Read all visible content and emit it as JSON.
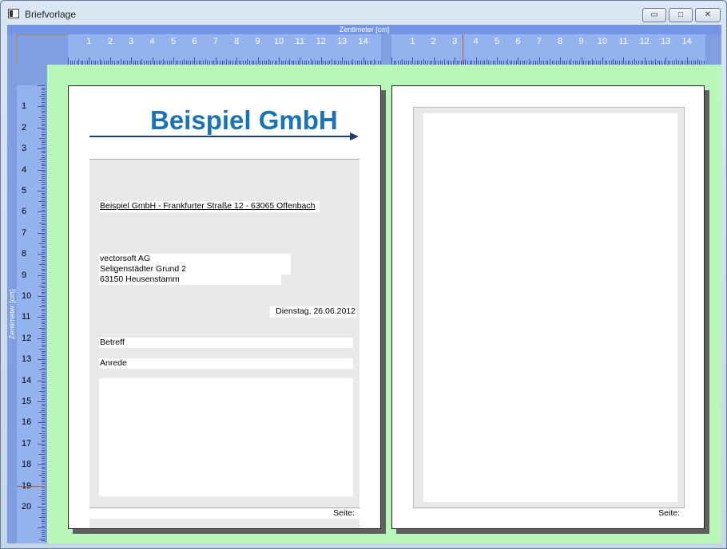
{
  "window": {
    "title": "Briefvorlage",
    "minimize": "▭",
    "maximize": "□",
    "close": "✕"
  },
  "ruler": {
    "top_caption": "Zentimeter [cm]",
    "left_caption": "Zentimeter [cm]",
    "top_labels_1": [
      "1",
      "2",
      "3",
      "4",
      "5",
      "6",
      "7",
      "8",
      "9",
      "10",
      "11",
      "12",
      "13",
      "14"
    ],
    "top_labels_2": [
      "1",
      "2",
      "3",
      "4",
      "5",
      "6",
      "7",
      "8",
      "9",
      "10",
      "11",
      "12",
      "13",
      "14"
    ],
    "left_labels": [
      "1",
      "2",
      "3",
      "4",
      "5",
      "6",
      "7",
      "8",
      "9",
      "10",
      "11",
      "12",
      "13",
      "14",
      "15",
      "16",
      "17",
      "18",
      "19",
      "20"
    ]
  },
  "page1": {
    "logo": "Beispiel GmbH",
    "sender_line": "Beispiel GmbH - Frankfurter Straße 12 - 63065 Offenbach",
    "recipient": [
      "vectorsoft AG",
      "Seligenstädter Grund 2",
      "63150  Heusenstamm"
    ],
    "date": "Dienstag, 26.06.2012",
    "subject": "Betreff",
    "salutation": "Anrede",
    "page_label": "Seite:"
  },
  "page2": {
    "page_label": "Seite:"
  },
  "colors": {
    "logo": "#1a73b8",
    "arrow": "#1f3b73",
    "canvas": "#b8f7b8",
    "ruler": "#94b2ee"
  }
}
